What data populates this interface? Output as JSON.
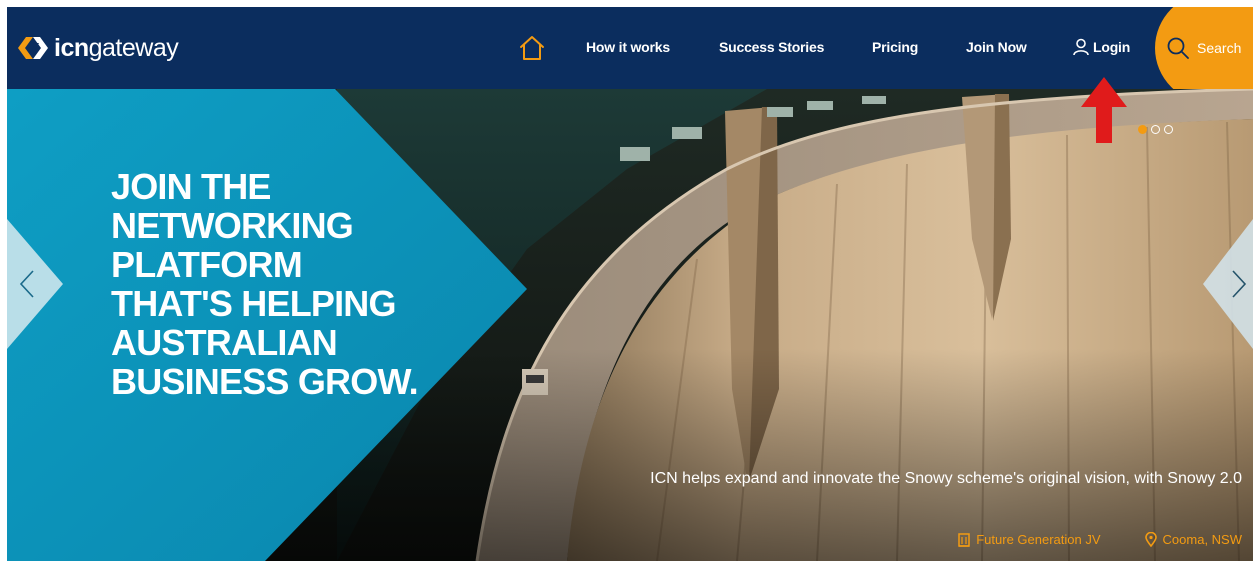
{
  "brand": {
    "name_bold": "icn",
    "name_light": "gateway"
  },
  "nav": {
    "home_icon": "home-icon",
    "items": [
      {
        "label": "How it works"
      },
      {
        "label": "Success Stories"
      },
      {
        "label": "Pricing"
      },
      {
        "label": "Join Now"
      }
    ],
    "login_label": "Login",
    "search_label": "Search"
  },
  "hero": {
    "headline": "JOIN THE\nNETWORKING\nPLATFORM\nTHAT'S HELPING\nAUSTRALIAN\nBUSINESS GROW.",
    "caption": "ICN helps expand and innovate the Snowy scheme's original vision, with Snowy 2.0",
    "company": "Future Generation JV",
    "location": "Cooma, NSW",
    "slides_total": 3,
    "active_slide": 1
  },
  "colors": {
    "header_bg": "#0b2d5e",
    "accent_orange": "#f39b12",
    "teal_panel": "#0aa0c6",
    "annotation_arrow": "#e01b1b"
  },
  "icons": {
    "logo": "icn-logo-icon",
    "user": "user-icon",
    "search": "search-icon",
    "prev": "chevron-left-icon",
    "next": "chevron-right-icon",
    "building": "building-icon",
    "location": "map-pin-icon",
    "annotation": "red-arrow-icon"
  }
}
